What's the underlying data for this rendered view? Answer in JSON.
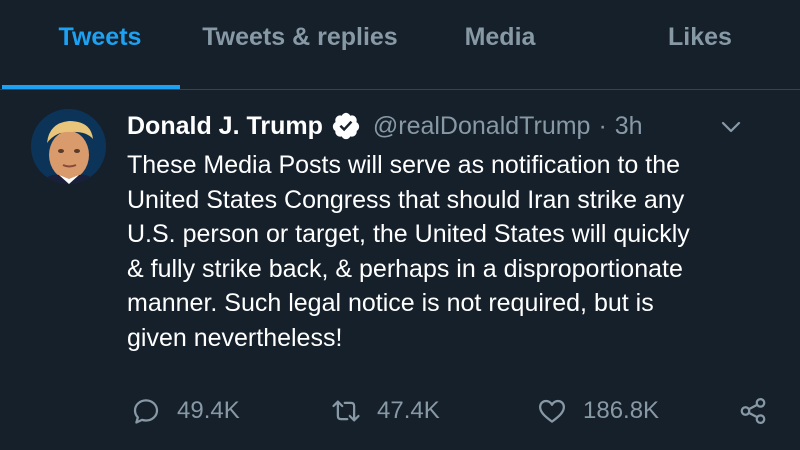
{
  "tabs": [
    {
      "label": "Tweets",
      "active": true
    },
    {
      "label": "Tweets & replies",
      "active": false
    },
    {
      "label": "Media",
      "active": false
    },
    {
      "label": "Likes",
      "active": false
    }
  ],
  "tweet": {
    "author_name": "Donald J. Trump",
    "verified": true,
    "handle": "@realDonaldTrump",
    "separator": "·",
    "time": "3h",
    "text": "These Media Posts will serve as notification to the\nUnited States Congress that should Iran strike any\nU.S. person or target, the United States will quickly\n& fully strike back, & perhaps in a disproportionate\nmanner. Such legal notice is not required, but is\ngiven nevertheless!",
    "replies": "49.4K",
    "retweets": "47.4K",
    "likes": "186.8K"
  },
  "icons": {
    "verified": "verified-badge-icon",
    "caret": "chevron-down-icon",
    "reply": "reply-icon",
    "retweet": "retweet-icon",
    "like": "heart-icon",
    "share": "share-icon"
  },
  "colors": {
    "background": "#15202b",
    "accent": "#1da1f2",
    "muted": "#8899a6",
    "divider": "#38444d"
  }
}
